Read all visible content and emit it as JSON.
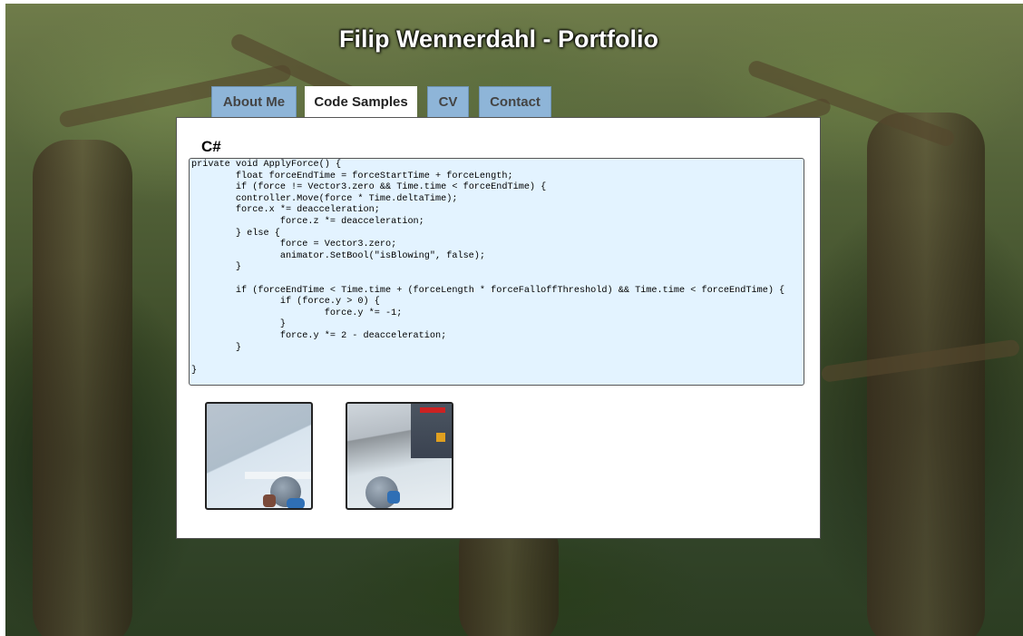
{
  "header": {
    "title": "Filip Wennerdahl - Portfolio"
  },
  "tabs": [
    {
      "label": "About Me",
      "active": false
    },
    {
      "label": "Code Samples",
      "active": true
    },
    {
      "label": "CV",
      "active": false
    },
    {
      "label": "Contact",
      "active": false
    }
  ],
  "code_sample": {
    "language": "C#",
    "code": "private void ApplyForce() {\n\tfloat forceEndTime = forceStartTime + forceLength;\n\tif (force != Vector3.zero && Time.time < forceEndTime) {\n\tcontroller.Move(force * Time.deltaTime);\n\tforce.x *= deacceleration;\n\t\tforce.z *= deacceleration;\n\t} else {\n\t\tforce = Vector3.zero;\n\t\tanimator.SetBool(\"isBlowing\", false);\n\t}\n\n\tif (forceEndTime < Time.time + (forceLength * forceFalloffThreshold) && Time.time < forceEndTime) {\n\t\tif (force.y > 0) {\n\t\t\tforce.y *= -1;\n\t\t}\n\t\tforce.y *= 2 - deacceleration;\n\t}\n\n}"
  },
  "thumbnails": [
    {
      "icon": "game-screenshot-robot-corridor"
    },
    {
      "icon": "game-screenshot-robot-machinery"
    }
  ],
  "colors": {
    "tab_inactive": "#8eb5d8",
    "code_background": "#e3f3ff",
    "panel_background": "#ffffff"
  }
}
